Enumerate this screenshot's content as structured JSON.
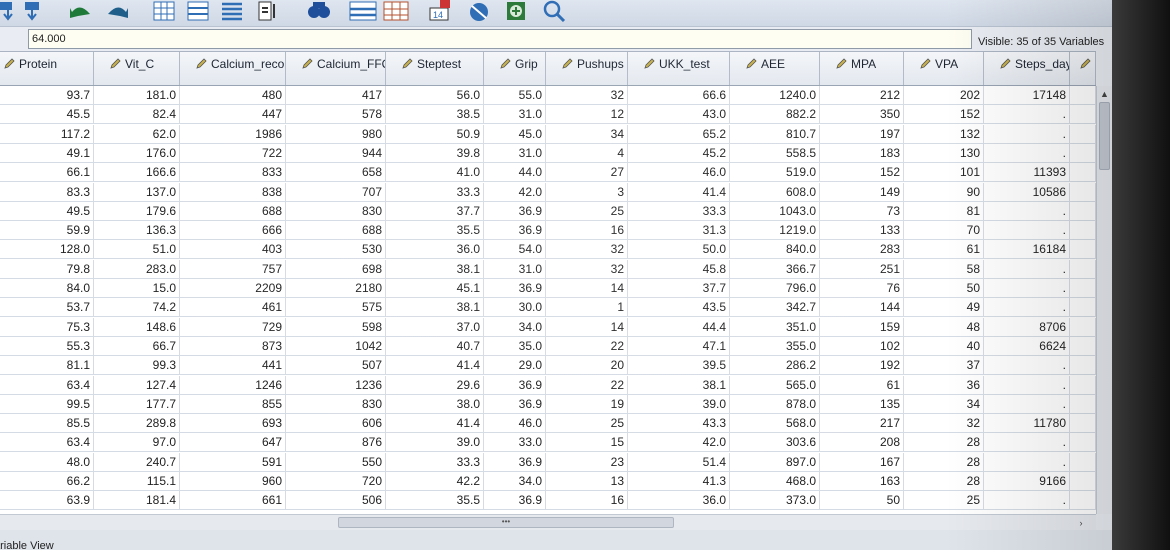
{
  "toolbar": {
    "icons": [
      "insert-cases-icon",
      "undo-icon",
      "redo-icon",
      "goto-case-icon",
      "goto-variable-icon",
      "variables-icon",
      "run-descriptives-icon",
      "find-icon",
      "insert-cases-grid-icon",
      "insert-variable-icon",
      "split-file-icon",
      "weight-cases-icon",
      "select-cases-icon",
      "value-labels-icon",
      "search-icon"
    ]
  },
  "cell_editor": {
    "value": "64.000"
  },
  "visible_label": "Visible: 35 of 35 Variables",
  "columns": [
    {
      "name": "Protein"
    },
    {
      "name": "Vit_C"
    },
    {
      "name": "Calcium_record"
    },
    {
      "name": "Calcium_FFQ"
    },
    {
      "name": "Steptest"
    },
    {
      "name": "Grip"
    },
    {
      "name": "Pushups"
    },
    {
      "name": "UKK_test"
    },
    {
      "name": "AEE"
    },
    {
      "name": "MPA"
    },
    {
      "name": "VPA"
    },
    {
      "name": "Steps_day"
    }
  ],
  "rows": [
    [
      "93.7",
      "181.0",
      "480",
      "417",
      "56.0",
      "55.0",
      "32",
      "66.6",
      "1240.0",
      "212",
      "202",
      "17148"
    ],
    [
      "45.5",
      "82.4",
      "447",
      "578",
      "38.5",
      "31.0",
      "12",
      "43.0",
      "882.2",
      "350",
      "152",
      "."
    ],
    [
      "117.2",
      "62.0",
      "1986",
      "980",
      "50.9",
      "45.0",
      "34",
      "65.2",
      "810.7",
      "197",
      "132",
      "."
    ],
    [
      "49.1",
      "176.0",
      "722",
      "944",
      "39.8",
      "31.0",
      "4",
      "45.2",
      "558.5",
      "183",
      "130",
      "."
    ],
    [
      "66.1",
      "166.6",
      "833",
      "658",
      "41.0",
      "44.0",
      "27",
      "46.0",
      "519.0",
      "152",
      "101",
      "11393"
    ],
    [
      "83.3",
      "137.0",
      "838",
      "707",
      "33.3",
      "42.0",
      "3",
      "41.4",
      "608.0",
      "149",
      "90",
      "10586"
    ],
    [
      "49.5",
      "179.6",
      "688",
      "830",
      "37.7",
      "36.9",
      "25",
      "33.3",
      "1043.0",
      "73",
      "81",
      "."
    ],
    [
      "59.9",
      "136.3",
      "666",
      "688",
      "35.5",
      "36.9",
      "16",
      "31.3",
      "1219.0",
      "133",
      "70",
      "."
    ],
    [
      "128.0",
      "51.0",
      "403",
      "530",
      "36.0",
      "54.0",
      "32",
      "50.0",
      "840.0",
      "283",
      "61",
      "16184"
    ],
    [
      "79.8",
      "283.0",
      "757",
      "698",
      "38.1",
      "31.0",
      "32",
      "45.8",
      "366.7",
      "251",
      "58",
      "."
    ],
    [
      "84.0",
      "15.0",
      "2209",
      "2180",
      "45.1",
      "36.9",
      "14",
      "37.7",
      "796.0",
      "76",
      "50",
      "."
    ],
    [
      "53.7",
      "74.2",
      "461",
      "575",
      "38.1",
      "30.0",
      "1",
      "43.5",
      "342.7",
      "144",
      "49",
      "."
    ],
    [
      "75.3",
      "148.6",
      "729",
      "598",
      "37.0",
      "34.0",
      "14",
      "44.4",
      "351.0",
      "159",
      "48",
      "8706"
    ],
    [
      "55.3",
      "66.7",
      "873",
      "1042",
      "40.7",
      "35.0",
      "22",
      "47.1",
      "355.0",
      "102",
      "40",
      "6624"
    ],
    [
      "81.1",
      "99.3",
      "441",
      "507",
      "41.4",
      "29.0",
      "20",
      "39.5",
      "286.2",
      "192",
      "37",
      "."
    ],
    [
      "63.4",
      "127.4",
      "1246",
      "1236",
      "29.6",
      "36.9",
      "22",
      "38.1",
      "565.0",
      "61",
      "36",
      "."
    ],
    [
      "99.5",
      "177.7",
      "855",
      "830",
      "38.0",
      "36.9",
      "19",
      "39.0",
      "878.0",
      "135",
      "34",
      "."
    ],
    [
      "85.5",
      "289.8",
      "693",
      "606",
      "41.4",
      "46.0",
      "25",
      "43.3",
      "568.0",
      "217",
      "32",
      "11780"
    ],
    [
      "63.4",
      "97.0",
      "647",
      "876",
      "39.0",
      "33.0",
      "15",
      "42.0",
      "303.6",
      "208",
      "28",
      "."
    ],
    [
      "48.0",
      "240.7",
      "591",
      "550",
      "33.3",
      "36.9",
      "23",
      "51.4",
      "897.0",
      "167",
      "28",
      "."
    ],
    [
      "66.2",
      "115.1",
      "960",
      "720",
      "42.2",
      "34.0",
      "13",
      "41.3",
      "468.0",
      "163",
      "28",
      "9166"
    ],
    [
      "63.9",
      "181.4",
      "661",
      "506",
      "35.5",
      "36.9",
      "16",
      "36.0",
      "373.0",
      "50",
      "25",
      "."
    ]
  ],
  "status": {
    "variable_view_tab": "ariable View"
  },
  "colors": {
    "accent": "#2f6db5",
    "grid_line": "#d5dbe4",
    "header_bg": "#e3e8ef"
  }
}
